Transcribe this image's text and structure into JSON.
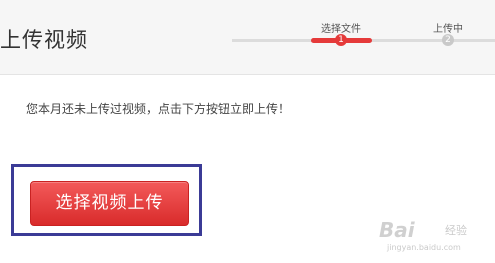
{
  "header": {
    "title": "上传视频",
    "steps": [
      {
        "label": "选择文件",
        "number": "1",
        "state": "active"
      },
      {
        "label": "上传中",
        "number": "2",
        "state": "inactive"
      }
    ]
  },
  "main": {
    "notice": "您本月还未上传过视频，点击下方按钮立即上传！",
    "upload_button_label": "选择视频上传"
  },
  "watermark": {
    "brand": "Bai",
    "side": "经验",
    "sub": "jingyan.baidu.com"
  },
  "colors": {
    "accent": "#e53a3a",
    "highlight_box": "#3b3b96"
  }
}
